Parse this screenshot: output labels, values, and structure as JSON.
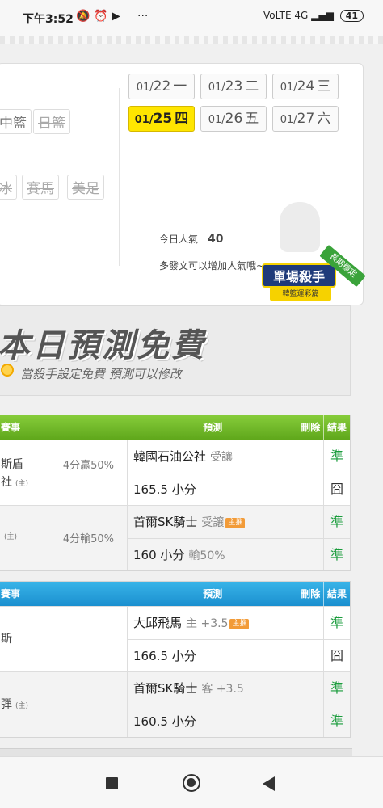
{
  "status": {
    "time": "下午3:52",
    "icons": [
      "mute-icon",
      "alarm-icon",
      "youtube-icon",
      "more-icon"
    ],
    "more": "···",
    "network": "VoLTE 4G",
    "battery": "41"
  },
  "categories": {
    "row1": [
      {
        "label": "中籃",
        "active": true
      },
      {
        "label": "日籃",
        "active": false
      }
    ],
    "row2": [
      {
        "label": "冰"
      },
      {
        "label": "賽馬"
      },
      {
        "label": "美足"
      }
    ]
  },
  "dates": [
    {
      "prefix": "01/",
      "day": "22",
      "weekday": "一",
      "active": false
    },
    {
      "prefix": "01/",
      "day": "23",
      "weekday": "二",
      "active": false
    },
    {
      "prefix": "01/",
      "day": "24",
      "weekday": "三",
      "active": false
    },
    {
      "prefix": "01/",
      "day": "25",
      "weekday": "四",
      "active": true
    },
    {
      "prefix": "01/",
      "day": "26",
      "weekday": "五",
      "active": false
    },
    {
      "prefix": "01/",
      "day": "27",
      "weekday": "六",
      "active": false
    }
  ],
  "popularity": {
    "label": "今日人氣",
    "value": "40",
    "hint": "多發文可以增加人氣哦~"
  },
  "badge": {
    "main": "單場殺手",
    "sub": "韓籃運彩篇",
    "ribbon": "長期穩定"
  },
  "promo": {
    "title": "本日預測免費",
    "subtitle": "當殺手設定免費 預測可以修改"
  },
  "table_headers": {
    "event": "賽事",
    "prediction": "預測",
    "delete": "刪除",
    "result": "結果"
  },
  "tables": [
    {
      "theme": "green",
      "groups": [
        {
          "shaded": false,
          "team_lines": [
            {
              "text": "斯盾",
              "tag": ""
            },
            {
              "text": "社",
              "tag": "(主)"
            }
          ],
          "odds": "4分贏50%",
          "rows": [
            {
              "pick": "韓國石油公社",
              "extra": "受讓",
              "home": "",
              "result": "準",
              "ok": true
            },
            {
              "pick": "165.5 小分",
              "extra": "",
              "home": "",
              "result": "囧",
              "ok": false
            }
          ]
        },
        {
          "shaded": true,
          "team_lines": [
            {
              "text": "",
              "tag": "(主)"
            }
          ],
          "odds": "4分輸50%",
          "rows": [
            {
              "pick": "首爾SK騎士",
              "extra": "受讓",
              "home": "主推",
              "result": "準",
              "ok": true
            },
            {
              "pick": "160 小分",
              "extra": "輸50%",
              "home": "",
              "result": "準",
              "ok": true
            }
          ]
        }
      ]
    },
    {
      "theme": "blue",
      "groups": [
        {
          "shaded": false,
          "team_lines": [
            {
              "text": "斯",
              "tag": ""
            }
          ],
          "odds": "",
          "rows": [
            {
              "pick": "大邱飛馬",
              "extra": "主 +3.5",
              "home": "主推",
              "result": "準",
              "ok": true
            },
            {
              "pick": "166.5 小分",
              "extra": "",
              "home": "",
              "result": "囧",
              "ok": false
            }
          ]
        },
        {
          "shaded": true,
          "team_lines": [
            {
              "text": "彈",
              "tag": "(主)"
            }
          ],
          "odds": "",
          "rows": [
            {
              "pick": "首爾SK騎士",
              "extra": "客 +3.5",
              "home": "",
              "result": "準",
              "ok": true
            },
            {
              "pick": "160.5 小分",
              "extra": "",
              "home": "",
              "result": "準",
              "ok": true
            }
          ]
        }
      ]
    }
  ],
  "colors": {
    "accent_yellow": "#ffe600",
    "green_header": "#6ab824",
    "blue_header": "#1f9ad6",
    "ok": "#1a9c3c"
  }
}
